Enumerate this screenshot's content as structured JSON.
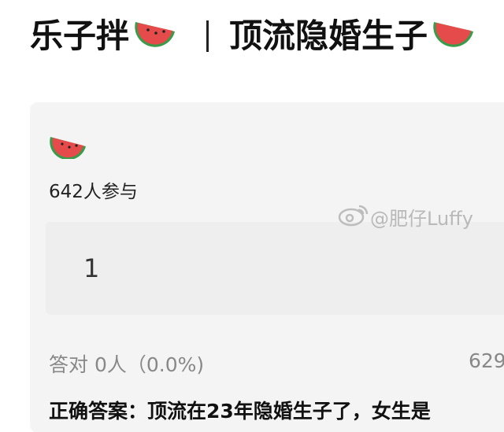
{
  "header": {
    "title_left": "乐子拌",
    "title_right": "顶流隐婚生子"
  },
  "card": {
    "participants": "642人参与",
    "option": "1",
    "stats": "答对  0人（0.0%)",
    "stats_right": "629",
    "answer": "正确答案：顶流在23年隐婚生子了，女生是"
  },
  "watermark": {
    "text": "@肥仔Luffy"
  },
  "icons": {
    "melon": "watermelon-icon",
    "weibo": "weibo-icon"
  },
  "colors": {
    "card_bg": "#f4f4f4",
    "melon_red": "#e64b4b",
    "melon_green": "#3a9b4a"
  }
}
